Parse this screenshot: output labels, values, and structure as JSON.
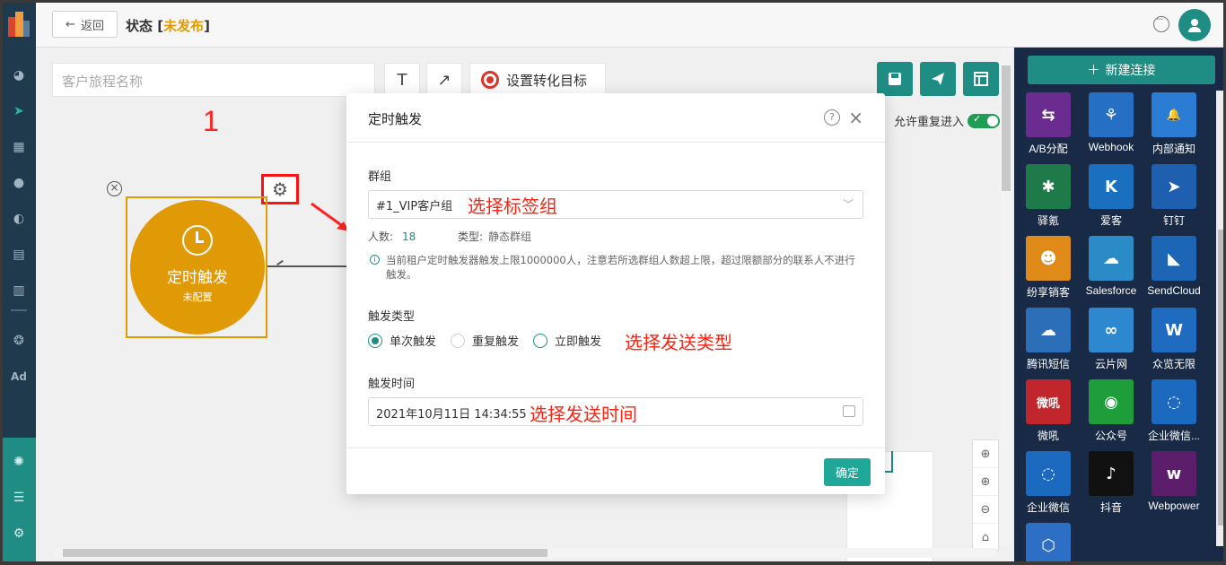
{
  "topbar": {
    "back_label": "返回",
    "status_label": "状态",
    "bracket_open": "[",
    "status_value": "未发布",
    "bracket_close": "]"
  },
  "toolbar": {
    "journey_name_placeholder": "客户旅程名称",
    "text_tool": "T",
    "arrow_tool": "↗",
    "goal_label": "设置转化目标",
    "allow_reentry": "允许重复进入"
  },
  "canvas": {
    "annotation_number": "1",
    "node_title": "定时触发",
    "node_subtitle": "未配置"
  },
  "palette": {
    "new_connection": "新建连接",
    "tiles": [
      {
        "label": "A/B分配",
        "color": "#6b2c8f",
        "icon": "ab-split-icon",
        "glyph": "⇆"
      },
      {
        "label": "Webhook",
        "color": "#2570c4",
        "icon": "webhook-icon",
        "glyph": "⚘"
      },
      {
        "label": "内部通知",
        "color": "#2b7cd3",
        "icon": "bell-icon",
        "glyph": "🔔"
      },
      {
        "label": "驿氪",
        "color": "#1f7a4a",
        "icon": "spider-icon",
        "glyph": "✱"
      },
      {
        "label": "爱客",
        "color": "#1a6fbf",
        "icon": "aike-icon",
        "glyph": "K"
      },
      {
        "label": "钉钉",
        "color": "#1f5fb0",
        "icon": "dingding-icon",
        "glyph": "➤"
      },
      {
        "label": "纷享销客",
        "color": "#e08a1a",
        "icon": "fxiaoke-icon",
        "glyph": "☻"
      },
      {
        "label": "Salesforce",
        "color": "#2a8bc7",
        "icon": "salesforce-icon",
        "glyph": "☁"
      },
      {
        "label": "SendCloud",
        "color": "#1d65b5",
        "icon": "sendcloud-icon",
        "glyph": "◣"
      },
      {
        "label": "腾讯短信",
        "color": "#2c6fb8",
        "icon": "tencent-sms-icon",
        "glyph": "☁"
      },
      {
        "label": "云片网",
        "color": "#2d88d0",
        "icon": "yunpian-icon",
        "glyph": "∞"
      },
      {
        "label": "众览无限",
        "color": "#1e6bc0",
        "icon": "zhonglan-icon",
        "glyph": "W"
      },
      {
        "label": "微吼",
        "color": "#c0262b",
        "icon": "weihou-icon",
        "glyph": "微吼"
      },
      {
        "label": "公众号",
        "color": "#1e9d3a",
        "icon": "wechat-icon",
        "glyph": "◉"
      },
      {
        "label": "企业微信...",
        "color": "#1b6ac0",
        "icon": "wecom-icon",
        "glyph": "◌"
      },
      {
        "label": "企业微信",
        "color": "#1b6ac0",
        "icon": "wecom-icon-2",
        "glyph": "◌"
      },
      {
        "label": "抖音",
        "color": "#111111",
        "icon": "douyin-icon",
        "glyph": "♪"
      },
      {
        "label": "Webpower",
        "color": "#5c1e6b",
        "icon": "webpower-icon",
        "glyph": "w"
      },
      {
        "label": "",
        "color": "#2d6fc4",
        "icon": "hexagon-icon",
        "glyph": "⬡"
      }
    ]
  },
  "modal": {
    "title": "定时触发",
    "help": "?",
    "close": "×",
    "group_label": "群组",
    "group_value": "#1_VIP客户组",
    "group_annotation": "选择标签组",
    "count_label": "人数:",
    "count_value": "18",
    "type_label": "类型:",
    "type_value": "静态群组",
    "info_text": "当前租户定时触发器触发上限1000000人，注意若所选群组人数超上限，超过限额部分的联系人不进行触发。",
    "trigger_type_label": "触发类型",
    "trigger_options": [
      "单次触发",
      "重复触发",
      "立即触发"
    ],
    "trigger_annotation": "选择发送类型",
    "trigger_time_label": "触发时间",
    "trigger_time_value": "2021年10月11日 14:34:55",
    "time_annotation": "选择发送时间",
    "ok_label": "确定"
  }
}
